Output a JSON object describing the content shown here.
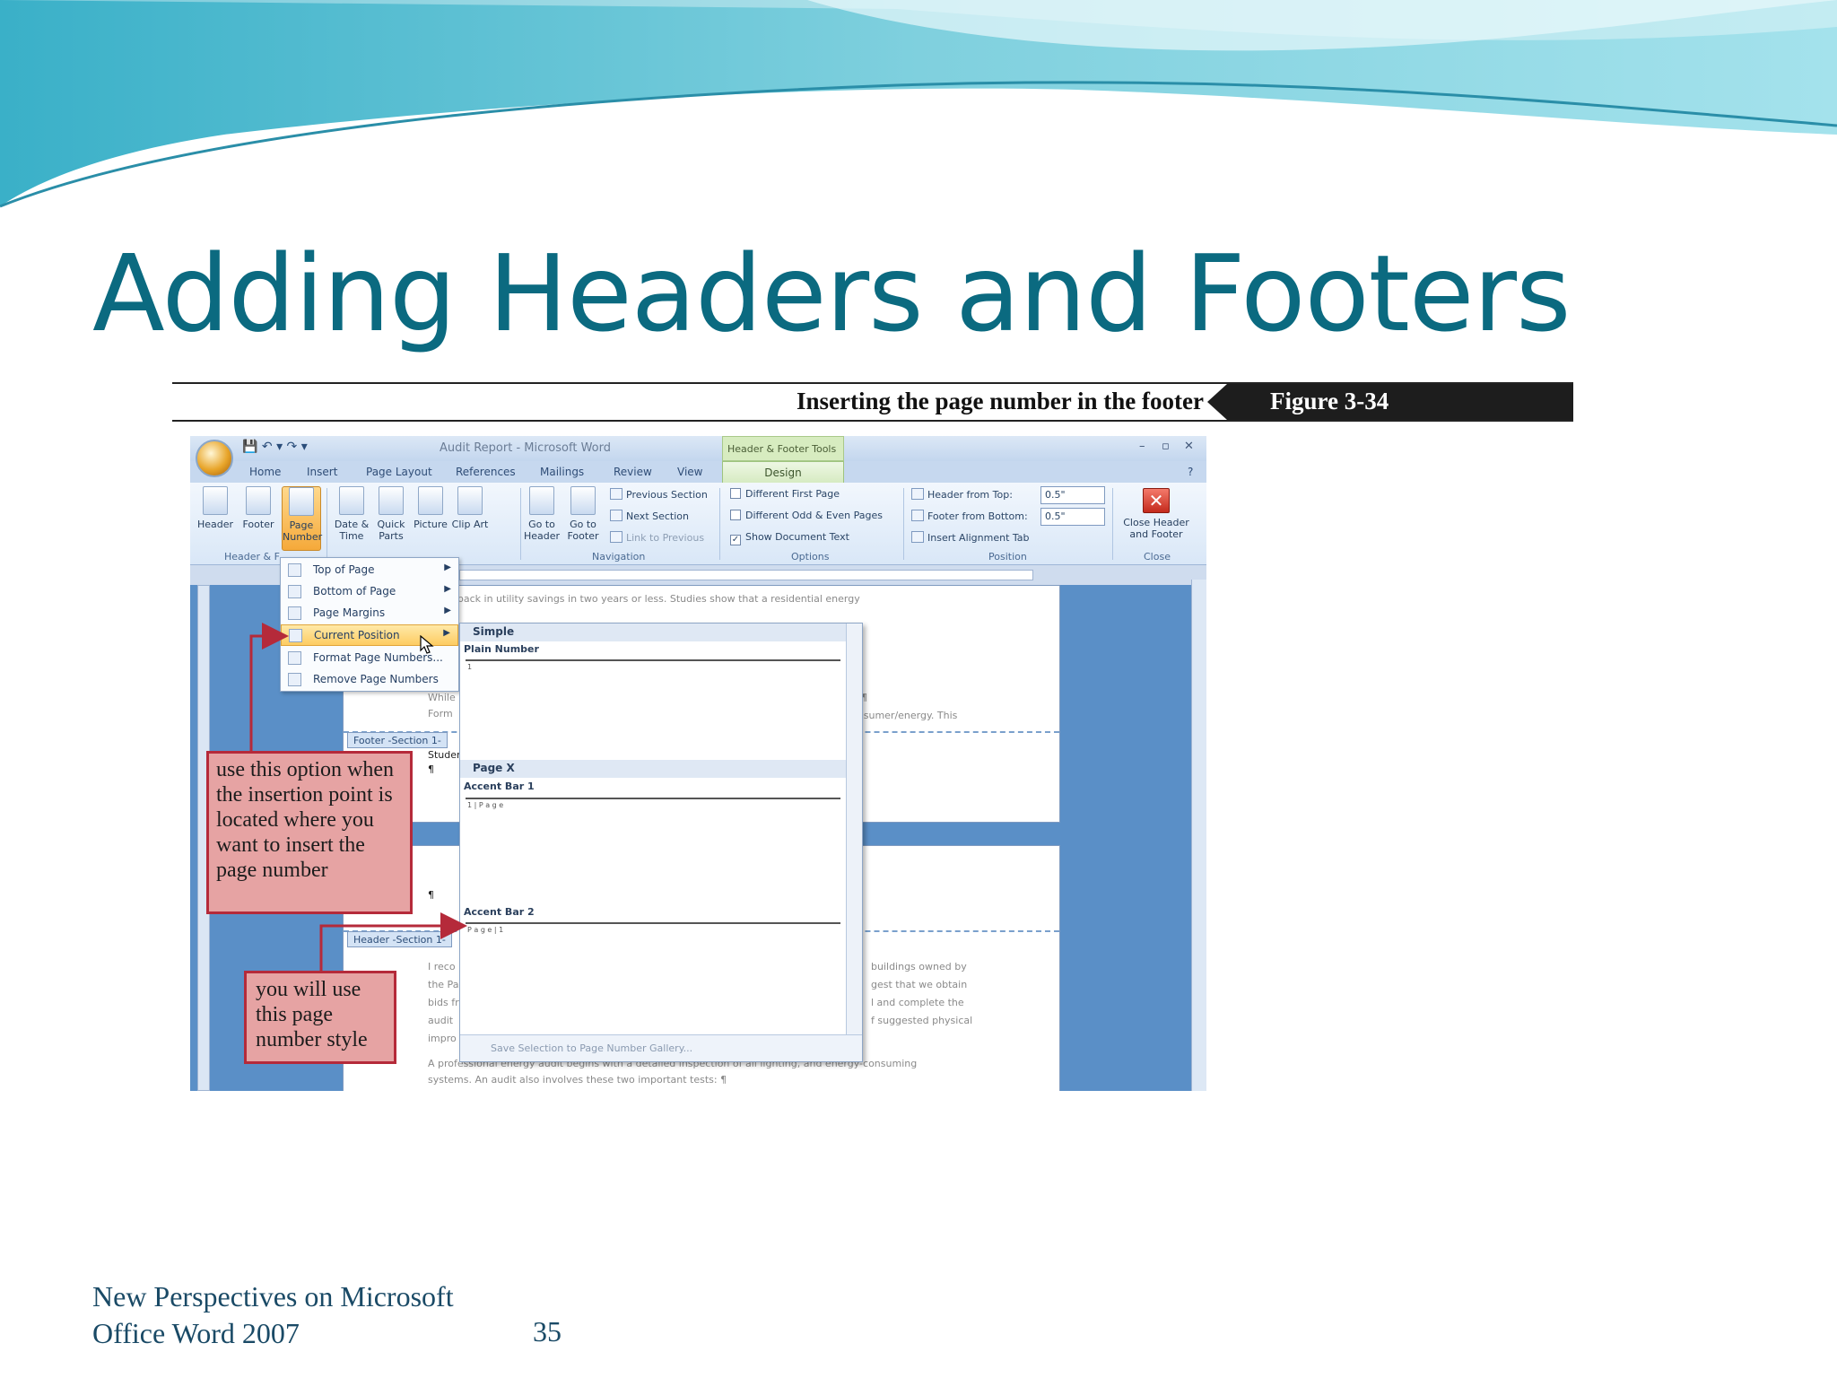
{
  "slide": {
    "title": "Adding Headers and Footers",
    "footer_line1": "New Perspectives on Microsoft",
    "footer_line2": "Office Word 2007",
    "page_number": "35",
    "accent_color": "#0b6a80"
  },
  "figure": {
    "caption": "Inserting the page number in the footer",
    "label": "Figure 3-34"
  },
  "word": {
    "window_title": "Audit Report - Microsoft Word",
    "context_title": "Header & Footer Tools",
    "tabs": [
      "Home",
      "Insert",
      "Page Layout",
      "References",
      "Mailings",
      "Review",
      "View"
    ],
    "active_tab": "Design",
    "ribbon": {
      "header": "Header",
      "footer": "Footer",
      "page_number": "Page Number",
      "date_time": "Date & Time",
      "quick_parts": "Quick Parts",
      "picture": "Picture",
      "clip_art": "Clip Art",
      "go_to_header": "Go to Header",
      "go_to_footer": "Go to Footer",
      "previous_section": "Previous Section",
      "next_section": "Next Section",
      "link_to_previous": "Link to Previous",
      "different_first_page": "Different First Page",
      "different_odd_even": "Different Odd & Even Pages",
      "show_document_text": "Show Document Text",
      "header_from_top": "Header from Top:",
      "header_from_top_value": "0.5\"",
      "footer_from_bottom": "Footer from Bottom:",
      "footer_from_bottom_value": "0.5\"",
      "insert_alignment_tab": "Insert Alignment Tab",
      "close_header_footer": "Close Header and Footer",
      "groups": {
        "header_footer": "Header & F",
        "navigation": "Navigation",
        "options": "Options",
        "position": "Position",
        "close": "Close"
      }
    },
    "menu": {
      "items": [
        "Top of Page",
        "Bottom of Page",
        "Page Margins",
        "Current Position",
        "Format Page Numbers...",
        "Remove Page Numbers"
      ]
    },
    "gallery": {
      "simple": "Simple",
      "plain_number": "Plain Number",
      "page_x": "Page X",
      "accent_bar_1": "Accent Bar 1",
      "accent_bar_1_preview": "1 | P a g e",
      "accent_bar_2": "Accent Bar 2",
      "accent_bar_2_preview": "P a g e | 1",
      "plain_preview": "1",
      "save_selection": "Save Selection to Page Number Gallery..."
    },
    "document": {
      "line1": "is usually earned back in utility savings in two years or less. Studies show that a residential energy",
      "line2": "ge.¶",
      "line3": "consumer/energy. This",
      "frag_while": "While",
      "frag_form": "Form",
      "frag_studer": "Studer",
      "pilcrow": "¶",
      "footer_tag": "Footer -Section 1-",
      "header_tag": "Header -Section 1-",
      "frag_ireco": "I reco",
      "frag_thepa": "the Pa",
      "frag_bidsfr": "bids fr",
      "frag_audit": "audit",
      "frag_impro": "impro",
      "r1": "buildings owned by",
      "r2": "gest that we obtain",
      "r3": "l and complete the",
      "r4": "f suggested physical",
      "bottom1": "A professional energy audit begins with a detailed inspection of all lighting, and energy-consuming",
      "bottom2": "systems. An audit also involves these two important tests: ¶"
    }
  },
  "callouts": {
    "current_position": "use this option when the insertion point is located where you want to insert the page number",
    "page_style": "you will use this page number style"
  }
}
